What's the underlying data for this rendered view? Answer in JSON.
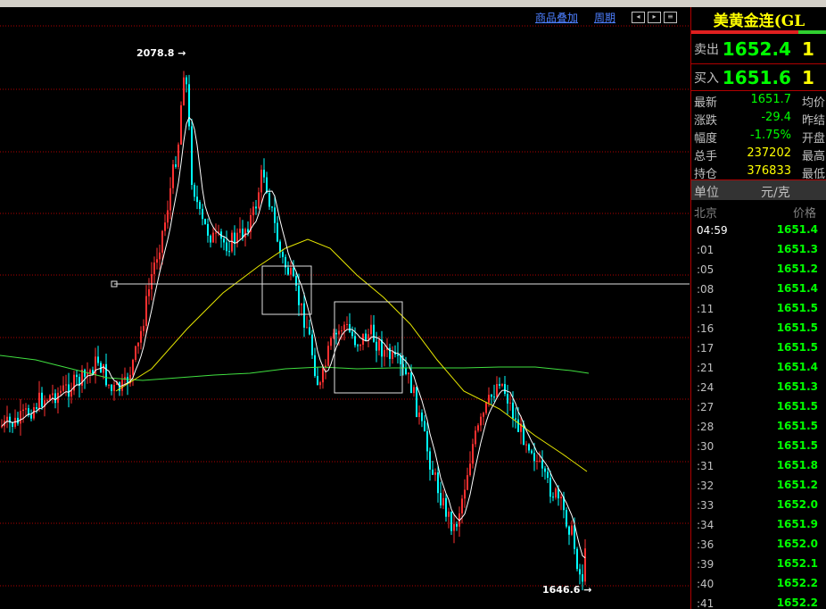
{
  "toolbar": {
    "overlay_label": "商品叠加",
    "period_label": "周期"
  },
  "chart_data": {
    "type": "candlestick",
    "high_label": "2078.8",
    "low_label": "1646.6",
    "grid": true,
    "grid_style": "dotted red horizontal",
    "indicators": [
      "white short moving average",
      "yellow medium moving average",
      "green long moving average"
    ],
    "crosshair": "horizontal",
    "boxes": 2,
    "colors": {
      "up": "#ff3030",
      "down": "#00ffff",
      "ma_short": "#ffffff",
      "ma_mid": "#e8e800",
      "ma_long": "#40e040",
      "grid": "#b00000"
    }
  },
  "panel": {
    "instrument": "美黄金连(GL",
    "sell": {
      "label": "卖出",
      "price": "1652.4",
      "volume": "1"
    },
    "buy": {
      "label": "买入",
      "price": "1651.6",
      "volume": "1"
    },
    "stats": [
      {
        "label": "最新",
        "value": "1651.7",
        "extra": "均价",
        "color": "#00ff00"
      },
      {
        "label": "涨跌",
        "value": "-29.4",
        "extra": "昨结",
        "color": "#00ff00"
      },
      {
        "label": "幅度",
        "value": "-1.75%",
        "extra": "开盘",
        "color": "#00ff00"
      },
      {
        "label": "总手",
        "value": "237202",
        "extra": "最高",
        "color": "#ffff00"
      },
      {
        "label": "持仓",
        "value": "376833",
        "extra": "最低",
        "color": "#ffff00"
      }
    ],
    "unit": {
      "label": "单位",
      "value": "元/克"
    },
    "tick_header": {
      "left": "北京",
      "right": "价格"
    },
    "ticks": [
      {
        "time": "04:59",
        "price": "1651.4"
      },
      {
        "time": ":01",
        "price": "1651.3"
      },
      {
        "time": ":05",
        "price": "1651.2"
      },
      {
        "time": ":08",
        "price": "1651.4"
      },
      {
        "time": ":11",
        "price": "1651.5"
      },
      {
        "time": ":16",
        "price": "1651.5"
      },
      {
        "time": ":17",
        "price": "1651.5"
      },
      {
        "time": ":21",
        "price": "1651.4"
      },
      {
        "time": ":24",
        "price": "1651.3"
      },
      {
        "time": ":27",
        "price": "1651.5"
      },
      {
        "time": ":28",
        "price": "1651.5"
      },
      {
        "time": ":30",
        "price": "1651.5"
      },
      {
        "time": ":31",
        "price": "1651.8"
      },
      {
        "time": ":32",
        "price": "1651.2"
      },
      {
        "time": ":33",
        "price": "1652.0"
      },
      {
        "time": ":34",
        "price": "1651.9"
      },
      {
        "time": ":36",
        "price": "1652.0"
      },
      {
        "time": ":39",
        "price": "1652.1"
      },
      {
        "time": ":40",
        "price": "1652.2"
      },
      {
        "time": ":41",
        "price": "1652.2"
      }
    ]
  }
}
